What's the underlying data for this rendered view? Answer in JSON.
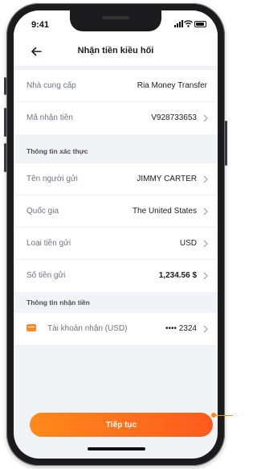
{
  "status_bar": {
    "time": "9:41"
  },
  "header": {
    "title": "Nhận tiền kiều hối"
  },
  "provider_section": {
    "rows": [
      {
        "label": "Nhà cung cấp",
        "value": "Ria Money Transfer"
      },
      {
        "label": "Mã nhận tiền",
        "value": "V928733653"
      }
    ]
  },
  "verification_section": {
    "title": "Thông tin xác thực",
    "rows": [
      {
        "label": "Tên người gửi",
        "value": "JIMMY CARTER"
      },
      {
        "label": "Quốc gia",
        "value": "The United States"
      },
      {
        "label": "Loại tiền gửi",
        "value": "USD"
      },
      {
        "label": "Số tiền gửi",
        "value": "1,234.56 $"
      }
    ]
  },
  "receive_section": {
    "title": "Thông tin nhận tiền",
    "rows": [
      {
        "label": "Tài khoản nhận (USD)",
        "value": "•••• 2324",
        "icon": "card-icon"
      }
    ]
  },
  "footer": {
    "continue_label": "Tiếp tục"
  },
  "colors": {
    "accent": "#ff7a1e",
    "background": "#f2f3f6"
  }
}
